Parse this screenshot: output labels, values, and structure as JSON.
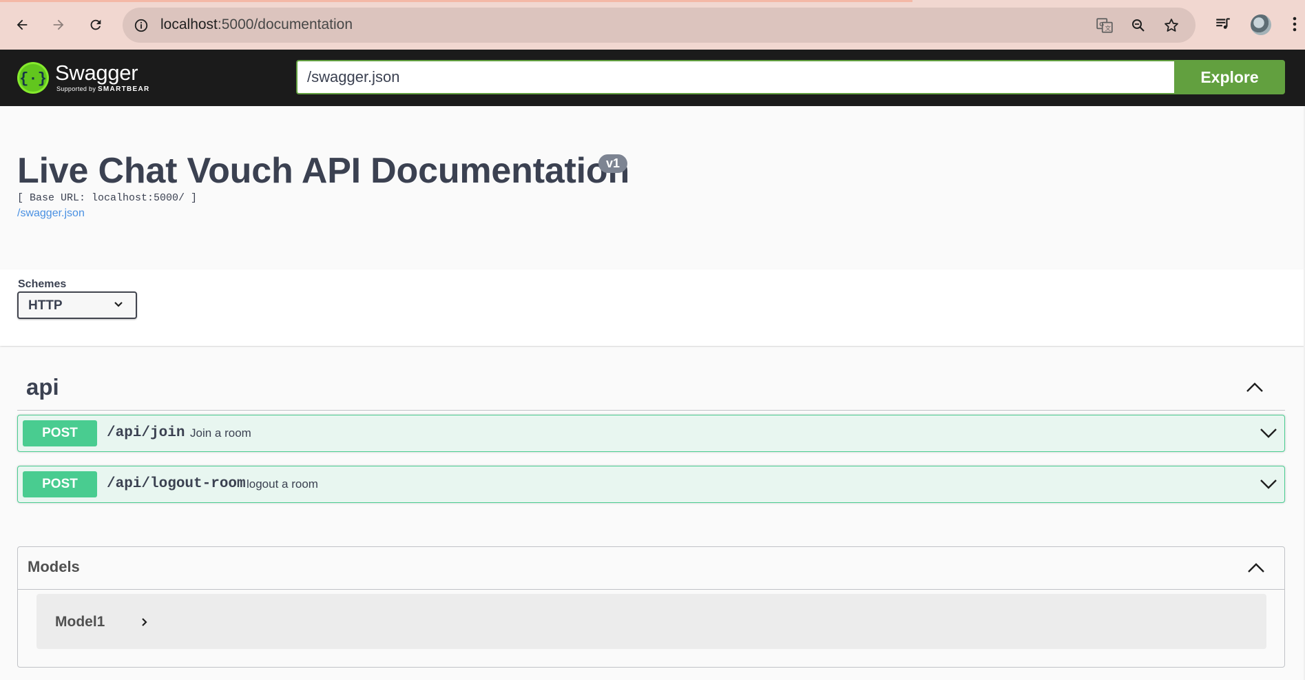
{
  "browser": {
    "url_host": "localhost",
    "url_path": ":5000/documentation"
  },
  "topbar": {
    "logo_name": "Swagger",
    "logo_supported_by": "Supported by",
    "logo_brand": "SMARTBEAR",
    "spec_url_value": "/swagger.json",
    "explore_label": "Explore"
  },
  "info": {
    "title": "Live Chat Vouch API Documentation",
    "version": "v1",
    "base_url": "[ Base URL: localhost:5000/ ]",
    "spec_link": "/swagger.json"
  },
  "schemes": {
    "label": "Schemes",
    "selected": "HTTP"
  },
  "tag": {
    "name": "api"
  },
  "operations": [
    {
      "method": "POST",
      "path": "/api/join",
      "summary": "Join a room"
    },
    {
      "method": "POST",
      "path": "/api/logout-room",
      "summary": "logout a room"
    }
  ],
  "models": {
    "title": "Models",
    "items": [
      {
        "name": "Model1"
      }
    ]
  },
  "colors": {
    "post": "#49cc90",
    "post_bg": "#e8f6f0",
    "swagger_green": "#62a03f",
    "topbar_bg": "#1b1b1b",
    "text": "#3b4151",
    "link": "#4990e2",
    "chrome_bg": "#f1d7d0"
  }
}
